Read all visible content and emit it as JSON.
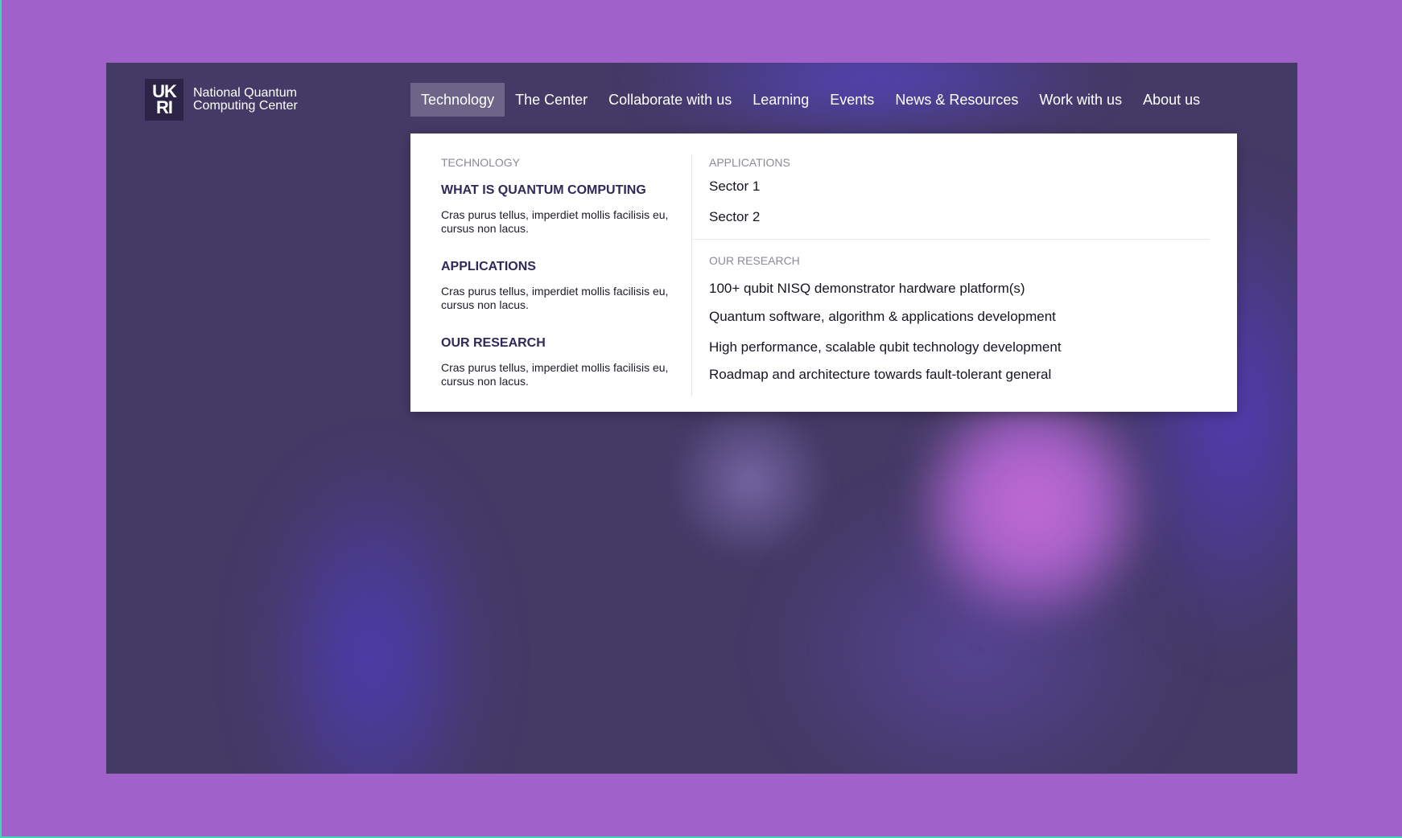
{
  "brand": {
    "logo_line1": "UK",
    "logo_line2": "RI",
    "name_line1": "National Quantum",
    "name_line2": "Computing Center"
  },
  "nav": {
    "items": [
      {
        "label": "Technology",
        "active": true
      },
      {
        "label": "The Center"
      },
      {
        "label": "Collaborate with us"
      },
      {
        "label": "Learning"
      },
      {
        "label": "Events"
      },
      {
        "label": "News & Resources"
      },
      {
        "label": "Work with us"
      },
      {
        "label": "About us"
      }
    ]
  },
  "mega_menu": {
    "left": {
      "label": "TECHNOLOGY",
      "blocks": [
        {
          "heading": "WHAT IS QUANTUM COMPUTING",
          "desc": "Cras purus tellus, imperdiet mollis facilisis eu, cursus non lacus."
        },
        {
          "heading": "APPLICATIONS",
          "desc": "Cras purus tellus, imperdiet mollis facilisis eu, cursus non lacus."
        },
        {
          "heading": "OUR RESEARCH",
          "desc": "Cras purus tellus, imperdiet mollis facilisis eu, cursus non lacus."
        }
      ]
    },
    "applications": {
      "label": "APPLICATIONS",
      "links": [
        "Sector 1",
        "Sector 2"
      ]
    },
    "research": {
      "label": "OUR RESEARCH",
      "links": [
        "100+ qubit NISQ demonstrator hardware platform(s)",
        "Quantum software, algorithm & applications development",
        "High performance, scalable qubit technology development",
        "Roadmap and architecture towards fault-tolerant general"
      ]
    }
  },
  "colors": {
    "page_background": "#a062ca",
    "hero_base": "#443a66",
    "heading_text": "#2d2a5a"
  }
}
